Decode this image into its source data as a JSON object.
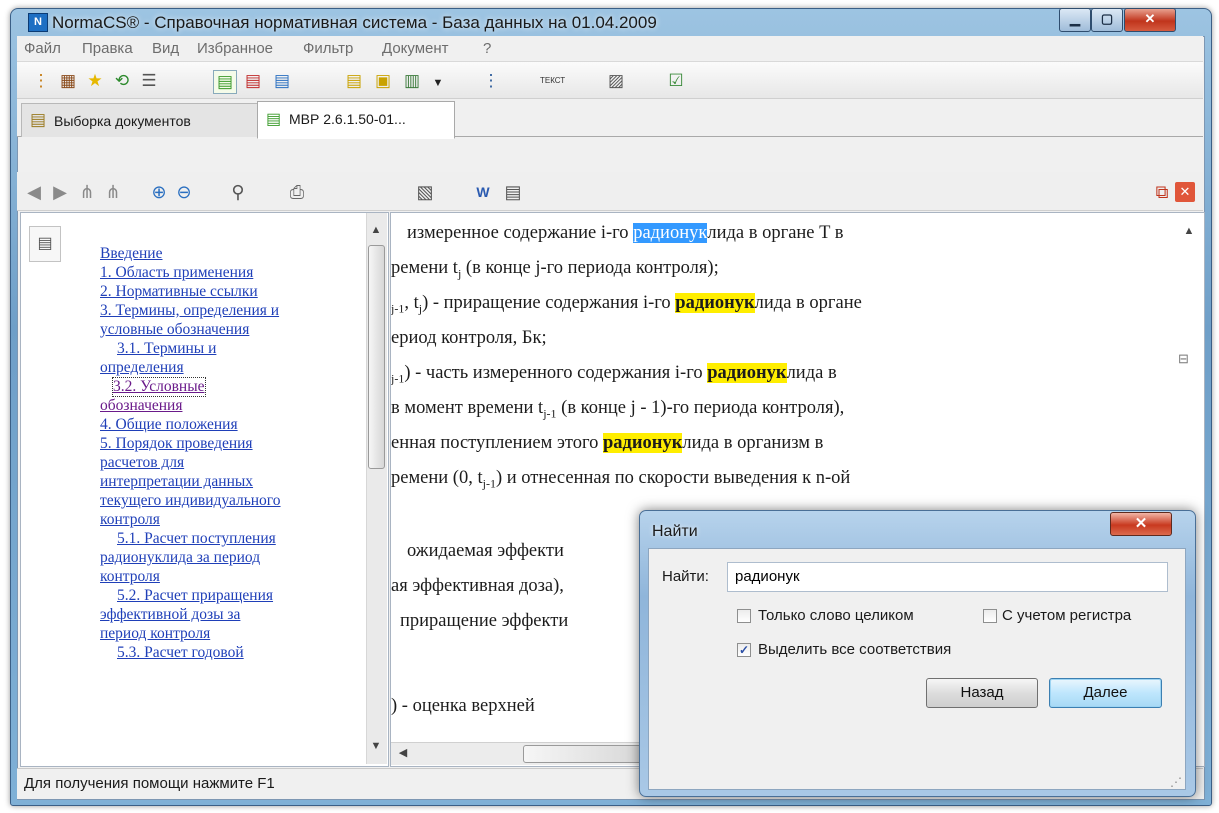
{
  "window": {
    "title": "NormaCS® - Справочная нормативная система - База данных на 01.04.2009",
    "app_icon": "normacs-app-icon",
    "controls": [
      "minimize-icon",
      "maximize-icon",
      "close-icon"
    ]
  },
  "menu": [
    "Файл",
    "Правка",
    "Вид",
    "Избранное",
    "Фильтр",
    "Документ",
    "?"
  ],
  "tabs": [
    {
      "label": "Выборка документов",
      "icon": "folder-list-icon",
      "active": false
    },
    {
      "label": "МВР 2.6.1.50-01...",
      "icon": "document-icon",
      "active": true
    }
  ],
  "toc": {
    "items": [
      "Введение",
      "1. Область применения",
      "2. Нормативные ссылки",
      "3. Термины, определения и",
      "условные обозначения",
      "3.1. Термины и",
      "определения",
      "3.2. Условные",
      "обозначения",
      "4. Общие положения",
      "5. Порядок проведения",
      "расчетов для",
      "интерпретации данных",
      "текущего индивидуального",
      "контроля",
      "5.1. Расчет поступления",
      "радионуклида за период",
      "контроля",
      "5.2. Расчет приращения",
      "эффективной дозы за",
      "период контроля",
      "5.3. Расчет годовой"
    ]
  },
  "document": {
    "lines": [
      {
        "pre": "измеренное содержание i-го ",
        "match": "радионук",
        "post": "лида в органе T в",
        "selected": true
      },
      {
        "pre": "ремени t",
        "sub": "j",
        "post2": " (в конце j-го периода контроля);"
      },
      {
        "pre": "",
        "sub": "j-1",
        "mid": ", t",
        "sub2": "j",
        "mid2": ") - приращение содержания i-го ",
        "match": "радионук",
        "post": "лида в органе"
      },
      {
        "pre": "ериод контроля, Бк;"
      },
      {
        "pre": "",
        "sub": "j-1",
        "mid": ") - часть измеренного содержания i-го ",
        "match": "радионук",
        "post": "лида в"
      },
      {
        "pre": "в момент времени t",
        "sub": "j-1",
        "post2": " (в конце j - 1)-го периода контроля),"
      },
      {
        "pre": "енная поступлением этого ",
        "match": "радионук",
        "post": "лида в организм в"
      },
      {
        "pre": "ремени (0, t",
        "sub": "j-1",
        "post2": ") и отнесенная по скорости выведения к n-ой"
      },
      {
        "pre": "ожидаемая эффекти"
      },
      {
        "pre": "ая эффективная доза),"
      },
      {
        "pre": "приращение эффекти"
      },
      {
        "pre": ")  -  оценка  верхней"
      }
    ]
  },
  "status": {
    "text": "Для получения помощи нажмите F1"
  },
  "find_dialog": {
    "title": "Найти",
    "find_label": "Найти:",
    "find_value": "радионук",
    "whole_word": {
      "label": "Только слово целиком",
      "checked": false
    },
    "match_case": {
      "label": "С учетом регистра",
      "checked": false
    },
    "highlight_all": {
      "label": "Выделить все соответствия",
      "checked": true
    },
    "back_button": "Назад",
    "next_button": "Далее"
  },
  "colors": {
    "highlight": "#ffee00",
    "selection": "#3399ff",
    "link": "#1f3fb8"
  }
}
